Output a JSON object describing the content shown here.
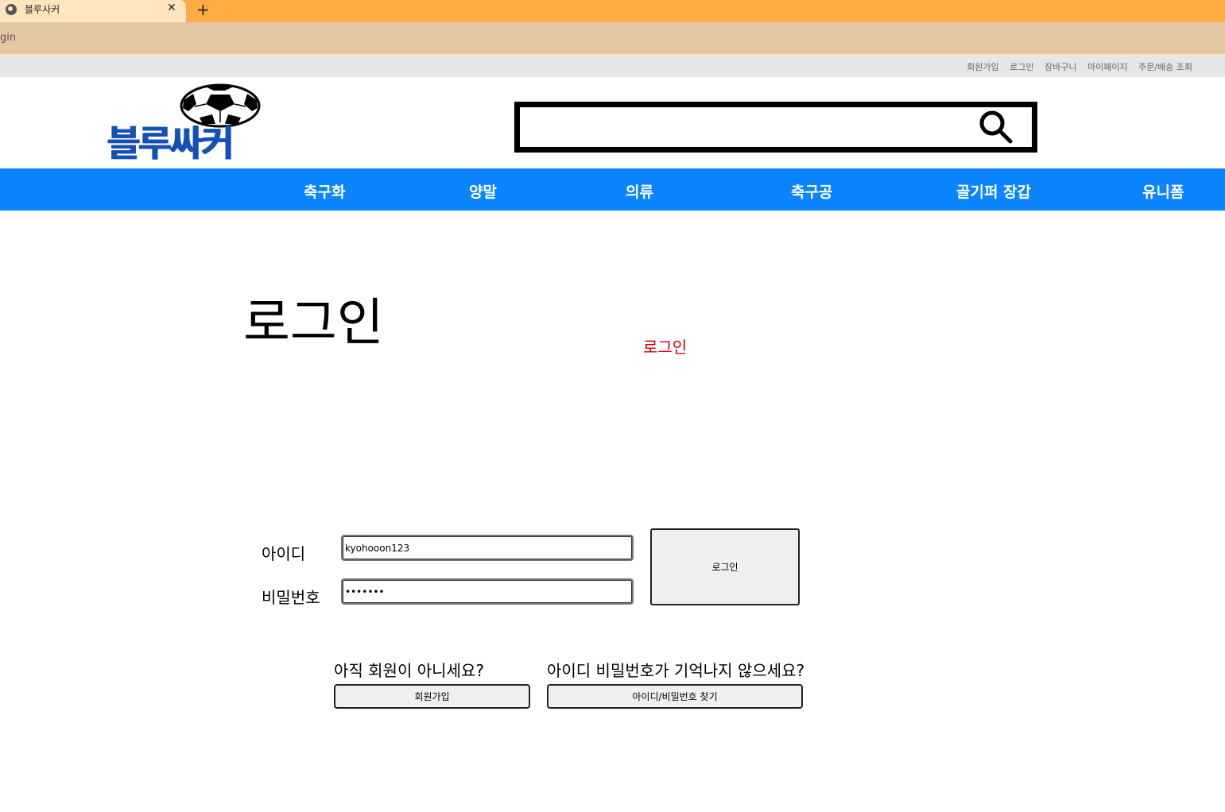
{
  "browser": {
    "tab_title": "블루사커",
    "tab_close": "✕",
    "new_tab": "+",
    "address": "gin"
  },
  "util_links": [
    "회원가입",
    "로그인",
    "장바구니",
    "마이페이지",
    "주문/배송 조회"
  ],
  "header": {
    "logo_text": "블루싸커"
  },
  "nav": [
    "축구화",
    "양말",
    "의류",
    "축구공",
    "골기퍼 장갑",
    "유니폼"
  ],
  "main": {
    "page_title": "로그인",
    "message": "로그인",
    "id_label": "아이디",
    "id_value": "kyohooon123",
    "pw_label": "비밀번호",
    "pw_value": "abcdefg",
    "login_button": "로그인",
    "signup_question": "아직 회원이 아니세요?",
    "signup_button": "회원가입",
    "find_question": "아이디 비밀번호가 기억나지 않으세요?",
    "find_button": "아이디/비밀번호 찾기"
  },
  "colors": {
    "nav_bg": "#0a84ff",
    "message": "#d40000",
    "logo": "#1550b8"
  }
}
